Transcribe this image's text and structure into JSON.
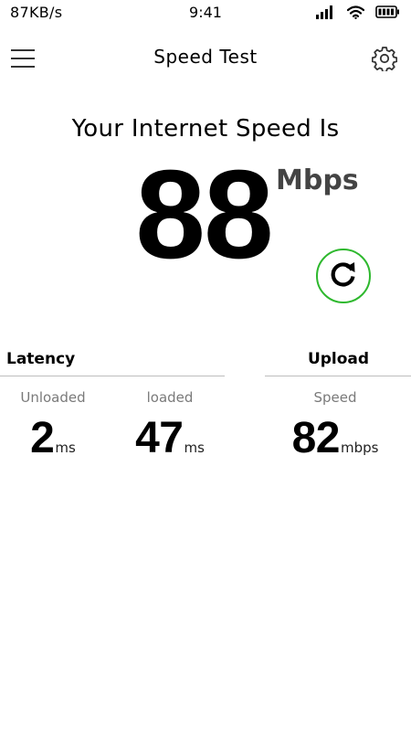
{
  "status_bar": {
    "network_speed": "87KB/s",
    "time": "9:41",
    "icons": [
      "signal-icon",
      "wifi-icon",
      "battery-icon"
    ]
  },
  "app_bar": {
    "title": "Speed Test",
    "menu_icon": "hamburger-menu-icon",
    "settings_icon": "gear-icon"
  },
  "main": {
    "headline": "Your Internet Speed Is",
    "speed_value": "88",
    "speed_unit": "Mbps",
    "refresh_icon": "refresh-icon"
  },
  "latency": {
    "heading": "Latency",
    "unloaded": {
      "label": "Unloaded",
      "value": "2",
      "unit": "ms"
    },
    "loaded": {
      "label": "loaded",
      "value": "47",
      "unit": "ms"
    }
  },
  "upload": {
    "heading": "Upload",
    "speed": {
      "label": "Speed",
      "value": "82",
      "unit": "mbps"
    }
  },
  "colors": {
    "accent_ring": "#2eb82e",
    "text_primary": "#000000",
    "text_muted": "#7a7a7a",
    "divider": "#bdbdbd"
  }
}
